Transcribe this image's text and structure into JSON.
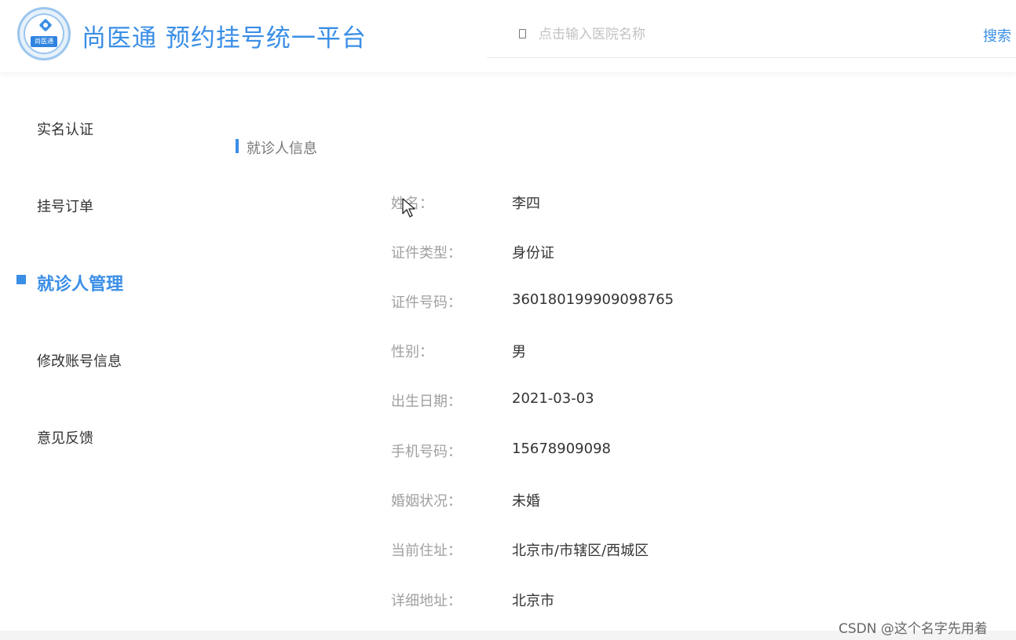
{
  "header": {
    "logo_text": "尚医通",
    "site_title": "尚医通 预约挂号统一平台",
    "search_placeholder": "点击输入医院名称",
    "search_button": "搜索"
  },
  "sidebar": {
    "items": [
      {
        "label": "实名认证",
        "active": false
      },
      {
        "label": "挂号订单",
        "active": false
      },
      {
        "label": "就诊人管理",
        "active": true
      },
      {
        "label": "修改账号信息",
        "active": false
      },
      {
        "label": "意见反馈",
        "active": false
      }
    ]
  },
  "main": {
    "section_title": "就诊人信息",
    "fields": [
      {
        "label": "姓名：",
        "value": "李四"
      },
      {
        "label": "证件类型：",
        "value": "身份证"
      },
      {
        "label": "证件号码：",
        "value": "360180199909098765"
      },
      {
        "label": "性别：",
        "value": "男"
      },
      {
        "label": "出生日期：",
        "value": "2021-03-03"
      },
      {
        "label": "手机号码：",
        "value": "15678909098"
      },
      {
        "label": "婚姻状况：",
        "value": "未婚"
      },
      {
        "label": "当前住址：",
        "value": "北京市/市辖区/西城区"
      },
      {
        "label": "详细地址：",
        "value": "北京市"
      }
    ]
  },
  "watermark": "CSDN @这个名字先用着",
  "colors": {
    "accent": "#3a8ee6",
    "label": "#a0a0a0",
    "value": "#333333"
  }
}
